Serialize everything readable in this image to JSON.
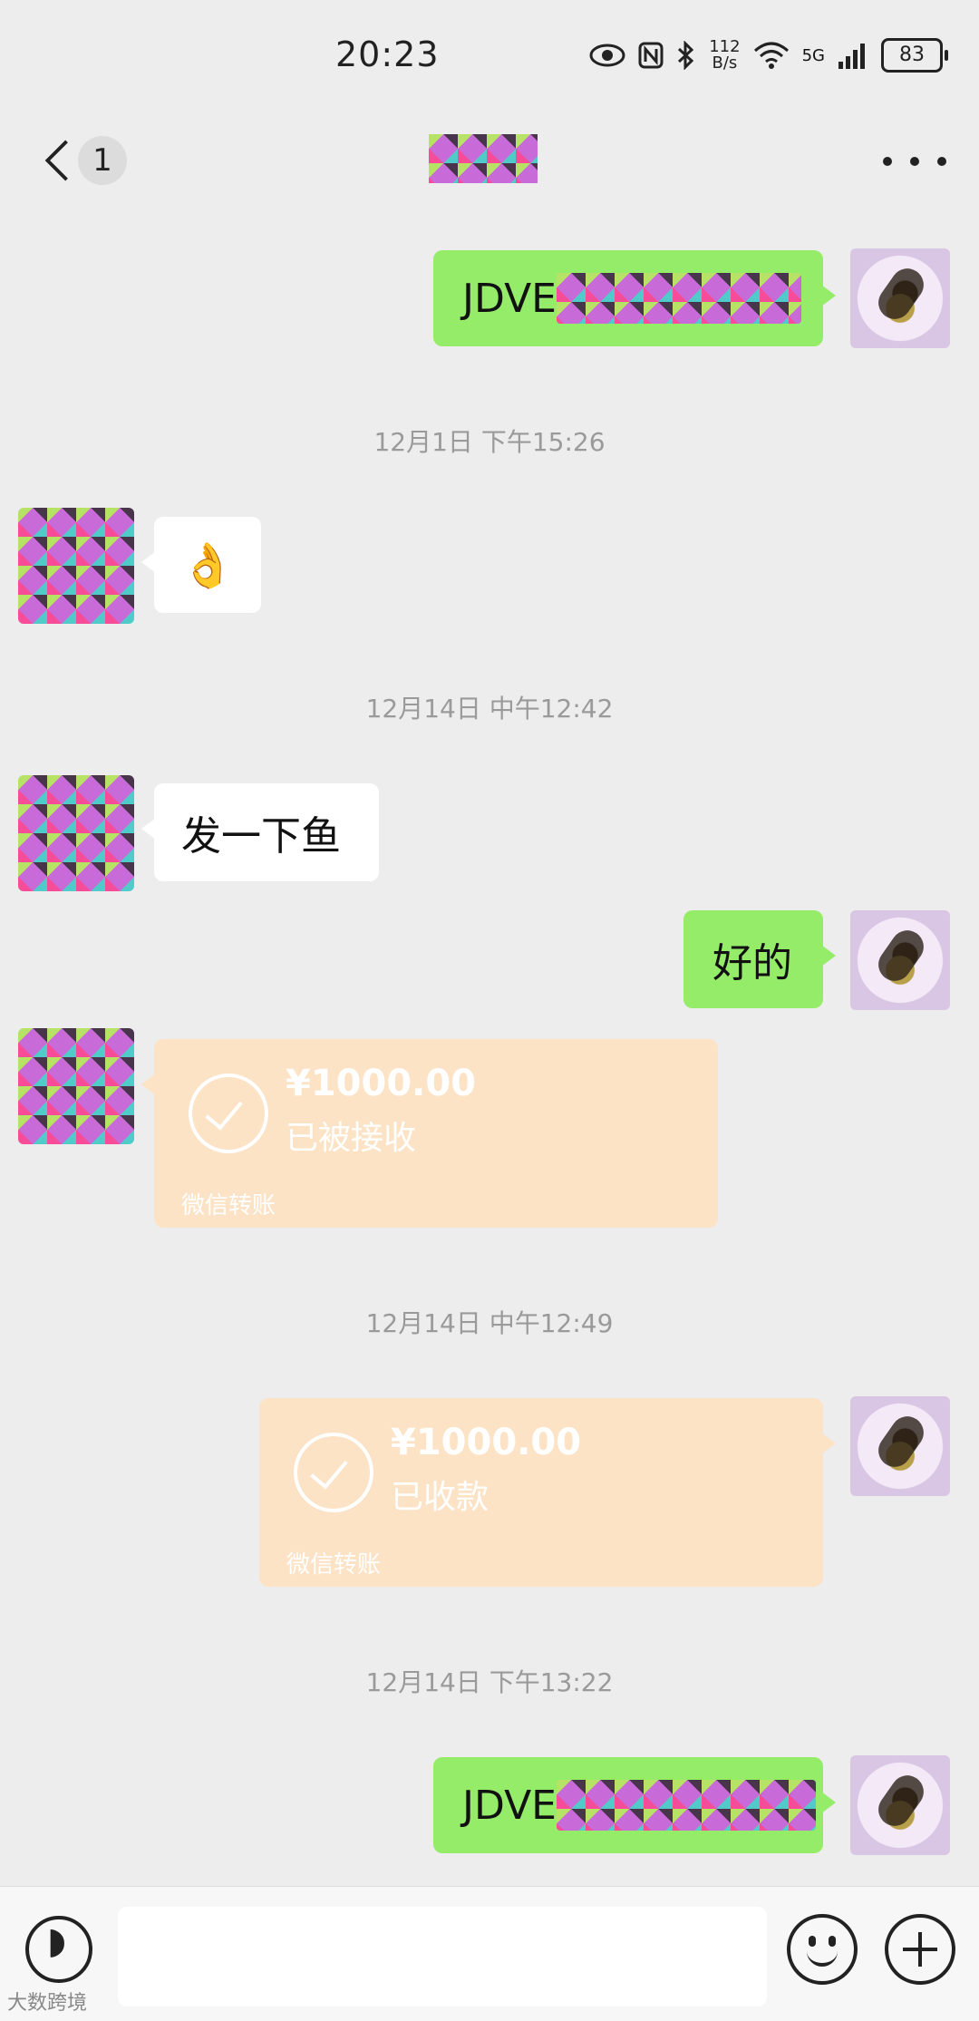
{
  "status_bar": {
    "time": "20:23",
    "net_speed_value": "112",
    "net_speed_unit": "B/s",
    "network": "5G",
    "battery": "83"
  },
  "header": {
    "unread_count": "1"
  },
  "messages": [
    {
      "side": "right",
      "type": "text",
      "text": "JDVE"
    },
    {
      "type": "timestamp",
      "text": "12月1日 下午15:26"
    },
    {
      "side": "left",
      "type": "emoji",
      "text": "👌"
    },
    {
      "type": "timestamp",
      "text": "12月14日 中午12:42"
    },
    {
      "side": "left",
      "type": "text",
      "text": "发一下鱼"
    },
    {
      "side": "right",
      "type": "text",
      "text": "好的"
    },
    {
      "side": "left",
      "type": "transfer",
      "amount": "¥1000.00",
      "status": "已被接收",
      "label": "微信转账"
    },
    {
      "type": "timestamp",
      "text": "12月14日 中午12:49"
    },
    {
      "side": "right",
      "type": "transfer",
      "amount": "¥1000.00",
      "status": "已收款",
      "label": "微信转账"
    },
    {
      "type": "timestamp",
      "text": "12月14日 下午13:22"
    },
    {
      "side": "right",
      "type": "text",
      "text": "JDVE"
    }
  ],
  "watermark": "大数跨境",
  "icons": {
    "back": "chevron-left-icon",
    "more": "ellipsis-icon",
    "voice": "voice-icon",
    "emoji": "emoji-icon",
    "plus": "plus-icon"
  },
  "colors": {
    "sent_bubble": "#95ec69",
    "received_bubble": "#ffffff",
    "transfer_card": "#fde3c6",
    "background": "#ededed"
  }
}
